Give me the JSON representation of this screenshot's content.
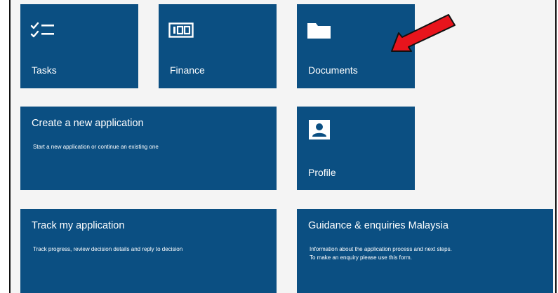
{
  "tiles": {
    "tasks": {
      "label": "Tasks",
      "icon": "checklist-icon"
    },
    "finance": {
      "label": "Finance",
      "icon": "money-icon"
    },
    "documents": {
      "label": "Documents",
      "icon": "folder-icon"
    },
    "create_application": {
      "title": "Create a new application",
      "description": "Start a new application or continue an existing one"
    },
    "profile": {
      "label": "Profile",
      "icon": "person-card-icon"
    },
    "track_application": {
      "title": "Track my application",
      "description": "Track progress, review decision details and reply to decision"
    },
    "guidance": {
      "title": "Guidance & enquiries Malaysia",
      "description_line1": "Information about the application process and next steps.",
      "description_line2": "To make an enquiry please use this form."
    }
  },
  "annotation": {
    "icon": "red-arrow-icon",
    "color": "#e8141c"
  },
  "colors": {
    "tile": "#0b4f82",
    "background": "#f4f4f4",
    "text": "#ffffff"
  }
}
